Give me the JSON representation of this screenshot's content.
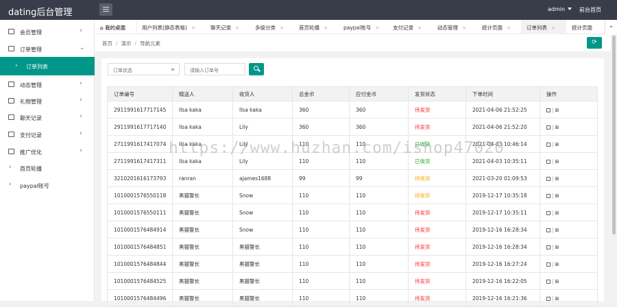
{
  "header": {
    "title": "dating后台管理",
    "user": "admin",
    "front_link": "前台首页"
  },
  "sidebar": {
    "items": [
      {
        "label": "会员管理"
      },
      {
        "label": "订单管理"
      },
      {
        "label": "订单列表"
      },
      {
        "label": "动态管理"
      },
      {
        "label": "礼物管理"
      },
      {
        "label": "聊天记录"
      },
      {
        "label": "支付记录"
      },
      {
        "label": "推广优化"
      },
      {
        "label": "首页轮播"
      },
      {
        "label": "paypal账号"
      }
    ],
    "expand_symbol": "‹",
    "collapse_symbol": "›"
  },
  "tabs": {
    "home": "我的桌面",
    "items": [
      {
        "label": "用户列表(静态表格)"
      },
      {
        "label": "聊天记录"
      },
      {
        "label": "多级分类"
      },
      {
        "label": "首页轮播"
      },
      {
        "label": "paypal账号"
      },
      {
        "label": "支付记录"
      },
      {
        "label": "动态管理"
      },
      {
        "label": "统计页面"
      },
      {
        "label": "订单列表"
      },
      {
        "label": "统计页面"
      }
    ],
    "close": "×",
    "more": "⌄"
  },
  "breadcrumb": [
    "首页",
    "演示",
    "导航元素"
  ],
  "breadcrumb_sep": "/",
  "filters": {
    "status_placeholder": "订单状态",
    "order_no_placeholder": "请输入订单号"
  },
  "table": {
    "columns": [
      "订单编号",
      "赠送人",
      "收货人",
      "总金币",
      "应付金币",
      "发货状态",
      "下单时间",
      "操作"
    ],
    "rows": [
      {
        "id": "2911991617717145",
        "giver": "Ilsa kaka",
        "receiver": "Ilsa kaka",
        "total": "360",
        "payable": "360",
        "status": "待发货",
        "time": "2021-04-06 21:52:25"
      },
      {
        "id": "2911991617717140",
        "giver": "Ilsa kaka",
        "receiver": "Lily",
        "total": "360",
        "payable": "360",
        "status": "待发货",
        "time": "2021-04-06 21:52:20"
      },
      {
        "id": "2711991617417074",
        "giver": "Ilsa kaka",
        "receiver": "Lily",
        "total": "110",
        "payable": "110",
        "status": "已收货",
        "time": "2021-04-03 10:46:14"
      },
      {
        "id": "2711991617417311",
        "giver": "Ilsa kaka",
        "receiver": "Lily",
        "total": "110",
        "payable": "110",
        "status": "已收货",
        "time": "2021-04-03 10:35:11"
      },
      {
        "id": "3210201616173793",
        "giver": "ranran",
        "receiver": "ajames1688",
        "total": "99",
        "payable": "99",
        "status": "待收货",
        "time": "2021-03-20 01:09:53"
      },
      {
        "id": "1010001576550118",
        "giver": "黑猫警长",
        "receiver": "Snow",
        "total": "110",
        "payable": "110",
        "status": "待收货",
        "time": "2019-12-17 10:35:18"
      },
      {
        "id": "1010001576550111",
        "giver": "黑猫警长",
        "receiver": "Snow",
        "total": "110",
        "payable": "110",
        "status": "待发货",
        "time": "2019-12-17 10:35:11"
      },
      {
        "id": "1010001576484914",
        "giver": "黑猫警长",
        "receiver": "Snow",
        "total": "110",
        "payable": "110",
        "status": "待发货",
        "time": "2019-12-16 16:28:34"
      },
      {
        "id": "1010001576484851",
        "giver": "黑猫警长",
        "receiver": "黑猫警长",
        "total": "110",
        "payable": "110",
        "status": "待发货",
        "time": "2019-12-16 16:28:34"
      },
      {
        "id": "1010001576484844",
        "giver": "黑猫警长",
        "receiver": "黑猫警长",
        "total": "110",
        "payable": "110",
        "status": "待发货",
        "time": "2019-12-16 16:27:24"
      },
      {
        "id": "1010001576484525",
        "giver": "黑猫警长",
        "receiver": "黑猫警长",
        "total": "110",
        "payable": "110",
        "status": "待发货",
        "time": "2019-12-16 16:22:05"
      },
      {
        "id": "1010001576484496",
        "giver": "黑猫警长",
        "receiver": "黑猫警长",
        "total": "110",
        "payable": "110",
        "status": "待发货",
        "time": "2019-12-16 16:21:36"
      }
    ],
    "action_sep": "|",
    "status_colors": {
      "待发货": "#ff2d2d",
      "已收货": "#2aa52a",
      "待收货": "#ffa500"
    }
  },
  "watermark": "https://www.huzhan.com/ishop47020",
  "colors": {
    "accent": "#009688",
    "topbar": "#393d49"
  }
}
